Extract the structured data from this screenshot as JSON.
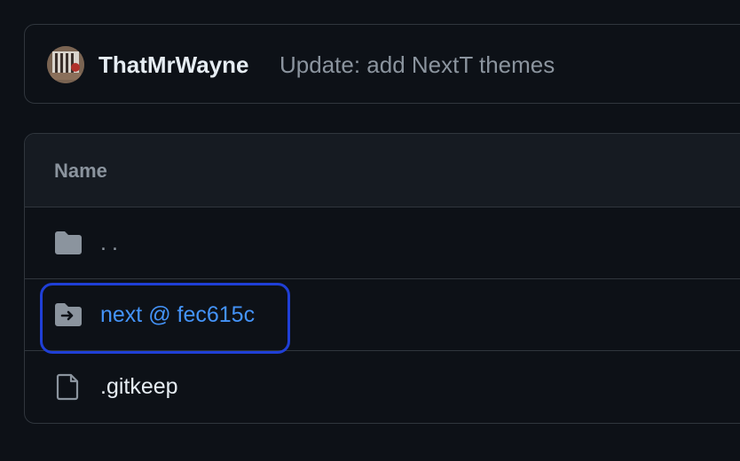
{
  "commit": {
    "author": "ThatMrWayne",
    "message": "Update: add NextT themes"
  },
  "table": {
    "column_name": "Name",
    "rows": [
      {
        "label": "..",
        "icon": "folder-icon",
        "kind": "parent-directory"
      },
      {
        "label": "next @ fec615c",
        "icon": "submodule-folder-icon",
        "kind": "submodule",
        "focused": true
      },
      {
        "label": ".gitkeep",
        "icon": "file-icon",
        "kind": "file"
      }
    ]
  },
  "colors": {
    "background": "#0d1117",
    "header_background": "#161b22",
    "border": "#30363d",
    "link": "#4493f8",
    "muted": "#8b949e",
    "focus_ring": "#1f3fd6"
  }
}
